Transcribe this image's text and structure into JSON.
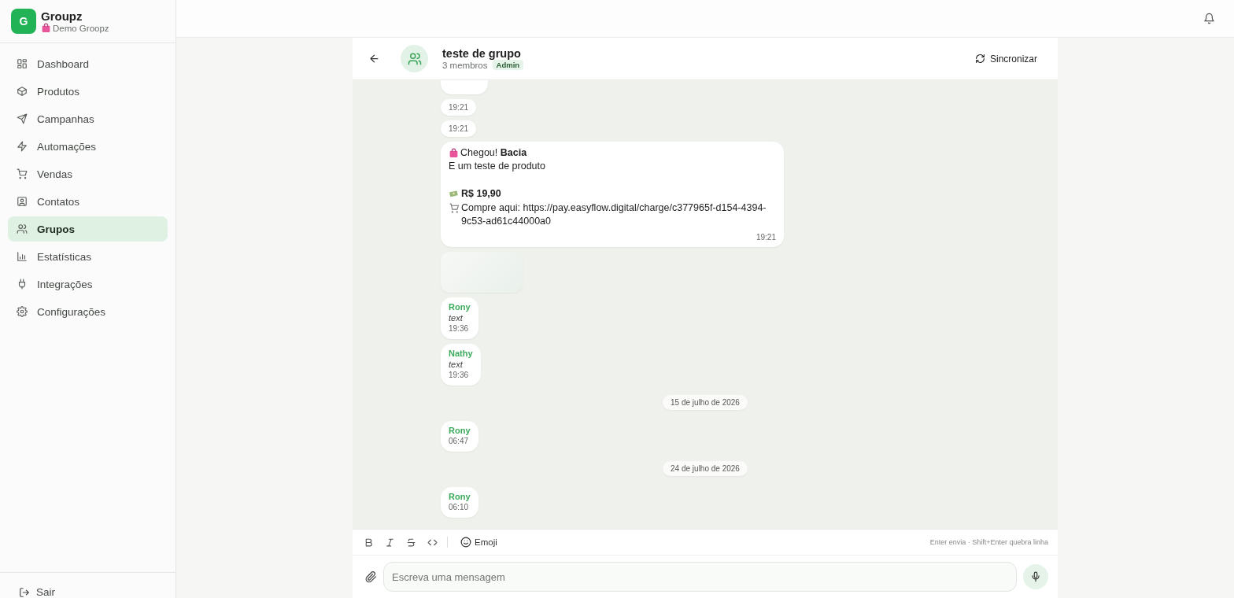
{
  "brand": {
    "logo_letter": "G",
    "name": "Groupz",
    "workspace": "Demo Groopz"
  },
  "sidebar": {
    "items": [
      {
        "label": "Dashboard",
        "selected": false
      },
      {
        "label": "Produtos",
        "selected": false
      },
      {
        "label": "Campanhas",
        "selected": false
      },
      {
        "label": "Automações",
        "selected": false
      },
      {
        "label": "Vendas",
        "selected": false
      },
      {
        "label": "Contatos",
        "selected": false
      },
      {
        "label": "Grupos",
        "selected": true
      },
      {
        "label": "Estatísticas",
        "selected": false
      },
      {
        "label": "Integrações",
        "selected": false
      },
      {
        "label": "Configurações",
        "selected": false
      }
    ],
    "logout": "Sair"
  },
  "chat": {
    "title": "teste de grupo",
    "members": "3 membros",
    "role_badge": "Admin",
    "sync_button": "Sincronizar",
    "messages": [
      {
        "kind": "clipped"
      },
      {
        "kind": "time",
        "time": "19:21"
      },
      {
        "kind": "time",
        "time": "19:21"
      },
      {
        "kind": "product",
        "lines": [
          {
            "kind": "headline",
            "text": "Chegou! **Bacia**"
          },
          {
            "kind": "plain",
            "text": "E um teste de produto"
          },
          {
            "kind": "blank"
          },
          {
            "kind": "price",
            "text": "**R$ 19,90**"
          },
          {
            "kind": "link",
            "text": "Compre aqui: https://pay.easyflow.digital/charge/c377965f-d154-4394-9c53-ad61c44000a0"
          }
        ],
        "time": "19:21"
      },
      {
        "kind": "media"
      },
      {
        "kind": "sender",
        "sender": "Rony",
        "text": "text",
        "time": "19:36"
      },
      {
        "kind": "sender",
        "sender": "Nathy",
        "text": "text",
        "time": "19:36"
      },
      {
        "kind": "date",
        "text": "15 de julho de 2026"
      },
      {
        "kind": "sender",
        "sender": "Rony",
        "time": "06:47"
      },
      {
        "kind": "date",
        "text": "24 de julho de 2026"
      },
      {
        "kind": "sender",
        "sender": "Rony",
        "time": "06:10"
      }
    ],
    "toolbar": {
      "emoji_button": "Emoji",
      "hint": "Enter envia · Shift+Enter quebra linha"
    },
    "composer": {
      "placeholder": "Escreva uma mensagem"
    }
  }
}
